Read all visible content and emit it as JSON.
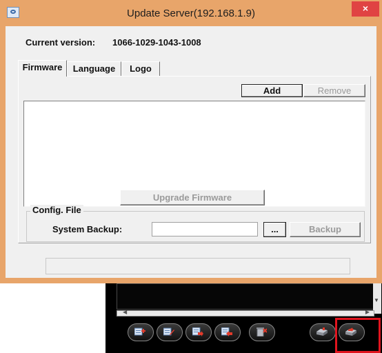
{
  "window": {
    "title": "Update Server(192.168.1.9)",
    "close_glyph": "×"
  },
  "version": {
    "label": "Current version:",
    "value": "1066-1029-1043-1008"
  },
  "tabs": [
    {
      "label": "Firmware",
      "active": true
    },
    {
      "label": "Language",
      "active": false
    },
    {
      "label": "Logo",
      "active": false
    }
  ],
  "firmware": {
    "add_label": "Add",
    "remove_label": "Remove",
    "upgrade_label": "Upgrade Firmware"
  },
  "config": {
    "legend": "Config. File",
    "backup_label": "System Backup:",
    "path_value": "",
    "browse_label": "...",
    "backup_button": "Backup"
  },
  "background_app": {
    "toolbar_icons": [
      "add-device-icon",
      "edit-device-icon",
      "import-icon",
      "export-icon",
      "delete-icon",
      "network-device-icon",
      "update-server-icon"
    ]
  }
}
